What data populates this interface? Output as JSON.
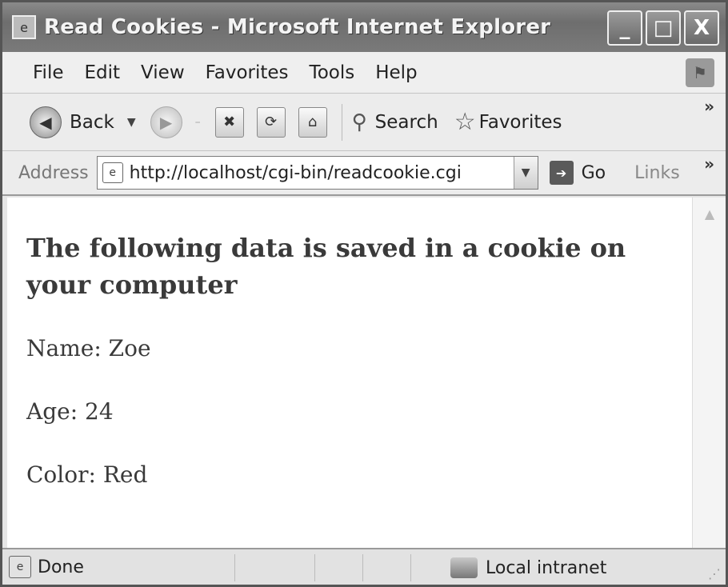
{
  "window": {
    "title": "Read Cookies - Microsoft Internet Explorer",
    "controls": {
      "minimize": "_",
      "maximize": "□",
      "close": "X"
    }
  },
  "menubar": {
    "items": [
      "File",
      "Edit",
      "View",
      "Favorites",
      "Tools",
      "Help"
    ]
  },
  "toolbar": {
    "back_label": "Back",
    "search_label": "Search",
    "favorites_label": "Favorites",
    "more": "»"
  },
  "addressbar": {
    "label": "Address",
    "url": "http://localhost/cgi-bin/readcookie.cgi",
    "go_label": "Go",
    "links_label": "Links",
    "more": "»"
  },
  "content": {
    "heading": "The following data is saved in a cookie on your computer",
    "lines": [
      "Name: Zoe",
      "Age: 24",
      "Color: Red"
    ]
  },
  "statusbar": {
    "status": "Done",
    "zone": "Local intranet"
  },
  "icons": [
    "ie-page-icon",
    "back-icon",
    "forward-icon",
    "stop-icon",
    "refresh-icon",
    "home-icon",
    "search-icon",
    "favorites-star-icon",
    "go-arrow-icon",
    "zone-icon"
  ]
}
